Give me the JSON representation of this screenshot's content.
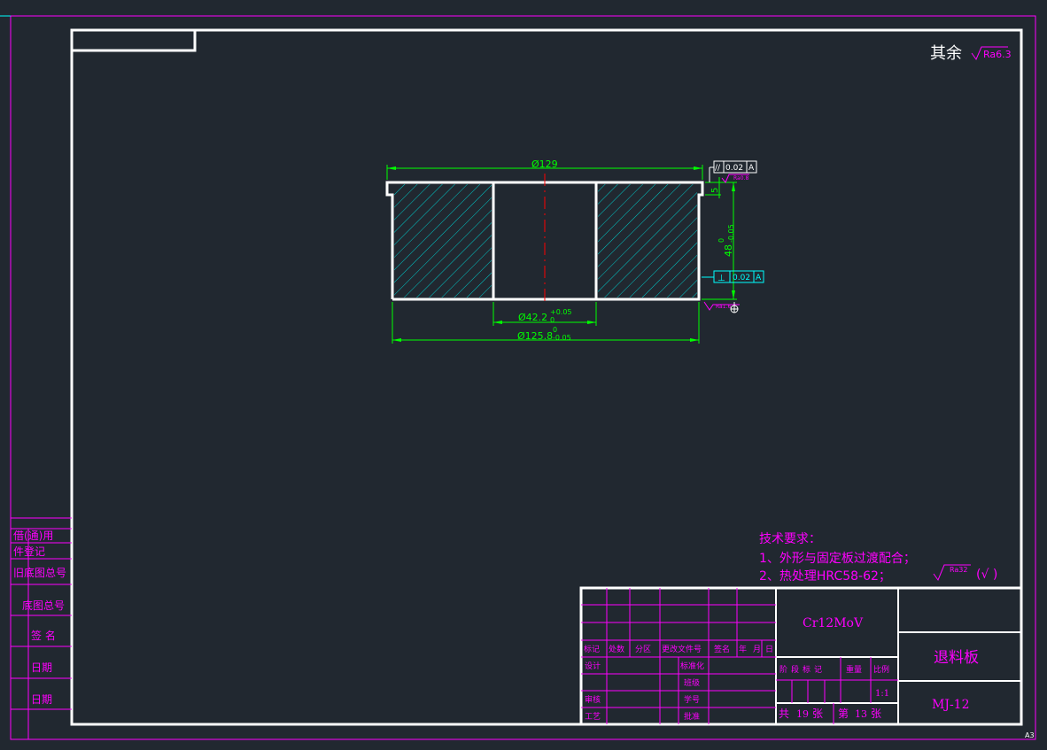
{
  "colors": {
    "background": "#212830",
    "frame": "#ffffff",
    "border": "#ff00ff",
    "dimension": "#00ff00",
    "tolerance": "#00ffff",
    "hatch": "#00c8c8",
    "center_line": "#ff0000",
    "annotation": "#ff00ff"
  },
  "roughness": {
    "qiyu": "其余",
    "qiyu_value": "Ra6.3",
    "small_value": "Ra0.8",
    "bottom_value": "Ra1.6",
    "note_value": "Ra32",
    "note_paren": "(√ )"
  },
  "dimensions": {
    "top_diameter": "Ø129",
    "hole_diameter": "Ø42.2",
    "hole_tol": "+0.05",
    "hole_tol_low": "0",
    "outer_diameter": "Ø125.8",
    "outer_tol_up": "0",
    "outer_tol_low": "-0.05",
    "height": "48",
    "height_tol_up": "0",
    "height_tol_low": "-0.05",
    "step": "5"
  },
  "gdt": {
    "parallel_symbol": "//",
    "parallel_value": "0.02",
    "parallel_datum": "A",
    "perp_symbol": "⊥",
    "perp_value": "0.02",
    "perp_datum": "A"
  },
  "notes": {
    "title": "技术要求：",
    "items": [
      "1、外形与固定板过渡配合；",
      "2、热处理HRC58-62；"
    ]
  },
  "left_panel": [
    "借(通)用",
    "件登记",
    "旧底图总号",
    "底图总号",
    "签 名",
    "日期",
    "日期"
  ],
  "title_block": {
    "material": "Cr12MoV",
    "part_name": "退料板",
    "drawing_no": "MJ-12",
    "rev_header": [
      "标记",
      "处数",
      "分区",
      "更改文件号",
      "签名",
      "年",
      "月",
      "日"
    ],
    "sign_left": [
      "设计",
      "审核",
      "工艺"
    ],
    "sign_mid": [
      "标准化",
      "班级",
      "学号",
      "批准"
    ],
    "stage_labels": [
      "阶段标记",
      "重量",
      "比例"
    ],
    "scale": "1:1",
    "sheet_gong": "共",
    "total": "19",
    "sheet_zhang": "张",
    "sheet_di": "第",
    "sheet_no": "13",
    "sheet_zhang2": "张"
  },
  "paper_size": "A3"
}
